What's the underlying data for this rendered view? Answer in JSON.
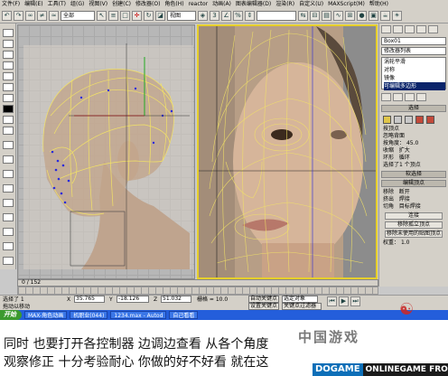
{
  "menubar": [
    "文件(F)",
    "编辑(E)",
    "工具(T)",
    "组(G)",
    "视图(V)",
    "创建(C)",
    "修改器(O)",
    "角色(H)",
    "reactor",
    "动画(A)",
    "图表编辑器(D)",
    "渲染(R)",
    "自定义(U)",
    "MAXScript(M)",
    "帮助(H)"
  ],
  "toolbar": {
    "selection_filter": "全部",
    "view_dropdown": "视图",
    "icon_names": [
      "undo-icon",
      "redo-icon",
      "link-icon",
      "unlink-icon",
      "bind-icon",
      "select-icon",
      "select-by-name-icon",
      "region-icon",
      "move-icon",
      "rotate-icon",
      "scale-icon",
      "snap-icon",
      "angle-snap-icon",
      "mirror-icon",
      "align-icon",
      "render-icon"
    ]
  },
  "command_panel": {
    "object_name": "Box01",
    "modifier_list_label": "修改器列表",
    "stack_items": [
      "涡轮平滑",
      "对称",
      "镜像",
      "可编辑多边形"
    ],
    "selection_rollout": "选择",
    "checkbox_back": "按顶点",
    "checkbox_ignore": "忽略背面",
    "angle_label": "按角度：",
    "angle_value": "45.0",
    "shrink_label": "收缩",
    "grow_label": "扩大",
    "ring_label": "环形",
    "loop_label": "循环",
    "selected_status": "选择了1 个顶点",
    "soft_select_rollout": "软选择",
    "edit_vertices_rollout": "编辑顶点",
    "remove_label": "移除",
    "break_label": "断开",
    "extrude_label": "挤出",
    "weld_label": "焊接",
    "chamfer_label": "切角",
    "target_weld_label": "目标焊接",
    "connect_label": "连接",
    "remove_isolated_label": "移除孤立顶点",
    "remove_unused_label": "移除未使用的贴图顶点",
    "weight_label": "权重：",
    "weight_value": "1.0"
  },
  "timeline": {
    "frame_label": "0 / 152"
  },
  "status": {
    "selection_text": "选择了 1",
    "x_label": "X",
    "x_value": "35.765",
    "y_label": "Y",
    "y_value": "-18.126",
    "z_label": "Z",
    "z_value": "51.032",
    "grid_label": "栅格 = 10.0",
    "auto_key": "自动关键点",
    "set_key": "设置关键点",
    "selected_dropdown": "选定对象",
    "key_filters": "关键点过滤器",
    "prompt": "拖动以移动"
  },
  "taskbar": {
    "start_label": "开始",
    "tasks": [
      "MAX-角色动画",
      "机职业(044)",
      "1234.max - Autod",
      "自己看看"
    ]
  },
  "caption": {
    "line1": "同时 也要打开各控制器  边调边查看 从各个角度",
    "line2": "观察修正  十分考验耐心 你做的好不好看 就在这"
  },
  "watermark": {
    "text": "中国游戏",
    "brand_left": "DOGAME",
    "brand_right": "ONLINEGAME FROUM"
  },
  "colors": {
    "active_viewport_border": "#e6cf2b",
    "wire_color": "#f2e266",
    "vertex_color": "#2a2adb",
    "taskbar_blue": "#245edb",
    "start_green": "#3c9a2e"
  }
}
